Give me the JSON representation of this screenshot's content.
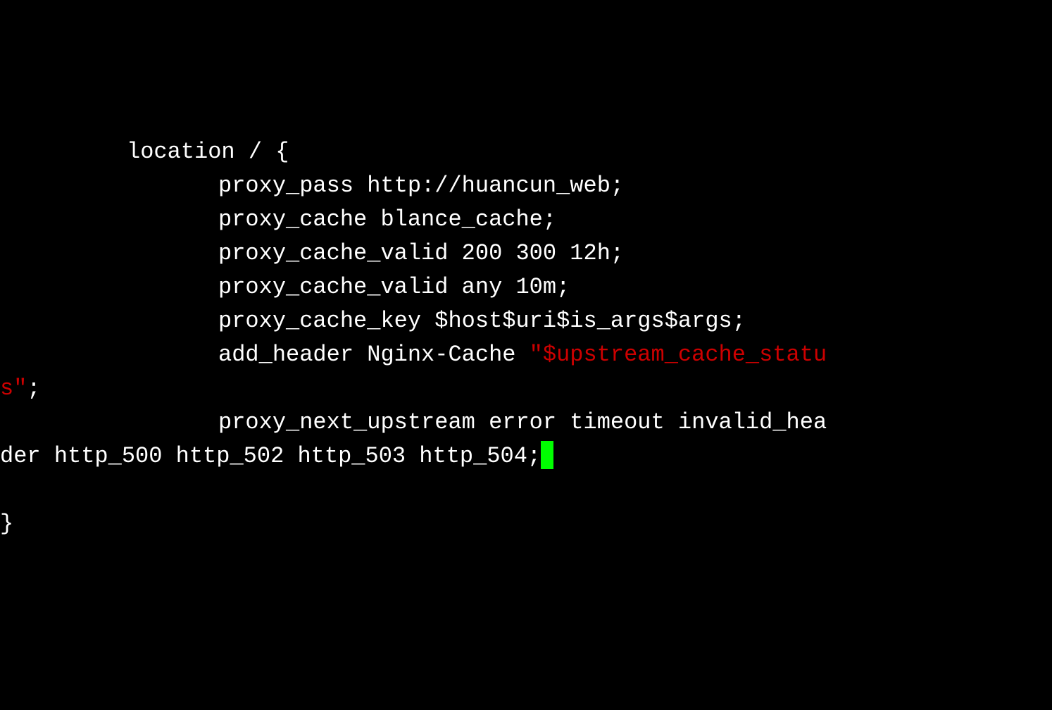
{
  "code": {
    "line1": "location / {",
    "line2": "proxy_pass http://huancun_web;",
    "line3": "proxy_cache blance_cache;",
    "line4": "proxy_cache_valid 200 300 12h;",
    "line5": "proxy_cache_valid any 10m;",
    "line6": "proxy_cache_key $host$uri$is_args$args;",
    "line7_part1": "add_header Nginx-Cache ",
    "line7_quote1": "\"$upstream_cache_statu",
    "line7_quote2": "s\"",
    "line7_semicolon": ";",
    "line8_part1": "proxy_next_upstream error timeout invalid_hea",
    "line8_part2": "der http_500 http_502 http_503 http_504;",
    "line9": "}"
  }
}
